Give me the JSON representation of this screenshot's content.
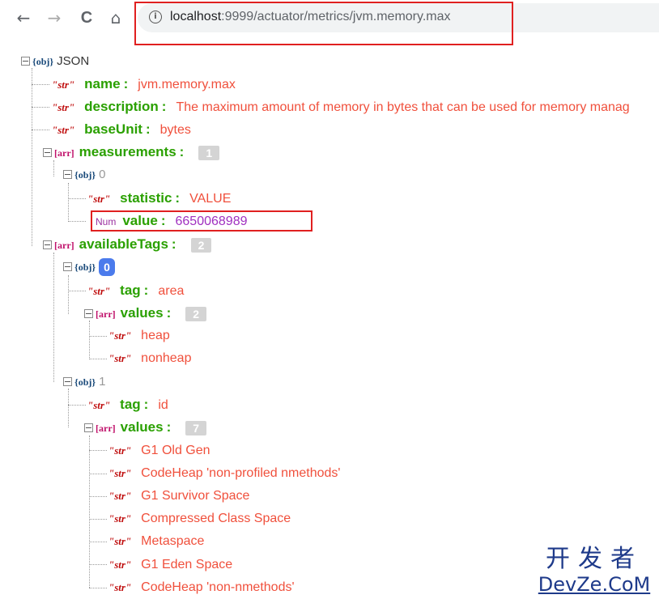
{
  "browser": {
    "back_icon": "←",
    "forward_icon": "→",
    "reload_icon": "C",
    "home_icon": "⌂",
    "info_icon": "i",
    "url_host": "localhost",
    "url_rest": ":9999/actuator/metrics/jvm.memory.max"
  },
  "tree": {
    "root_type": "{obj}",
    "root_label": "JSON",
    "name": {
      "type": "\"str\"",
      "key": "name",
      "value": "jvm.memory.max"
    },
    "description": {
      "type": "\"str\"",
      "key": "description",
      "value": "The maximum amount of memory in bytes that can be used for memory manag"
    },
    "baseUnit": {
      "type": "\"str\"",
      "key": "baseUnit",
      "value": "bytes"
    },
    "measurements": {
      "type": "[arr]",
      "key": "measurements",
      "count": "1",
      "item0": {
        "type": "{obj}",
        "index": "0",
        "statistic": {
          "type": "\"str\"",
          "key": "statistic",
          "value": "VALUE"
        },
        "value": {
          "type": "Num",
          "key": "value",
          "value": "6650068989"
        }
      }
    },
    "availableTags": {
      "type": "[arr]",
      "key": "availableTags",
      "count": "2",
      "item0": {
        "type": "{obj}",
        "index": "0",
        "tag": {
          "type": "\"str\"",
          "key": "tag",
          "value": "area"
        },
        "values": {
          "type": "[arr]",
          "key": "values",
          "count": "2",
          "items": [
            {
              "type": "\"str\"",
              "value": "heap"
            },
            {
              "type": "\"str\"",
              "value": "nonheap"
            }
          ]
        }
      },
      "item1": {
        "type": "{obj}",
        "index": "1",
        "tag": {
          "type": "\"str\"",
          "key": "tag",
          "value": "id"
        },
        "values": {
          "type": "[arr]",
          "key": "values",
          "count": "7",
          "items": [
            {
              "type": "\"str\"",
              "value": "G1 Old Gen"
            },
            {
              "type": "\"str\"",
              "value": "CodeHeap 'non-profiled nmethods'"
            },
            {
              "type": "\"str\"",
              "value": "G1 Survivor Space"
            },
            {
              "type": "\"str\"",
              "value": "Compressed Class Space"
            },
            {
              "type": "\"str\"",
              "value": "Metaspace"
            },
            {
              "type": "\"str\"",
              "value": "G1 Eden Space"
            },
            {
              "type": "\"str\"",
              "value": "CodeHeap 'non-nmethods'"
            }
          ]
        }
      }
    }
  },
  "watermark": {
    "cn": "开发者",
    "en": "DevZe.CoM"
  },
  "colors": {
    "key": "#2aa000",
    "string_value": "#f0503c",
    "number_value": "#a030c0",
    "highlight_border": "#e02020",
    "index_badge": "#4b7bec"
  }
}
